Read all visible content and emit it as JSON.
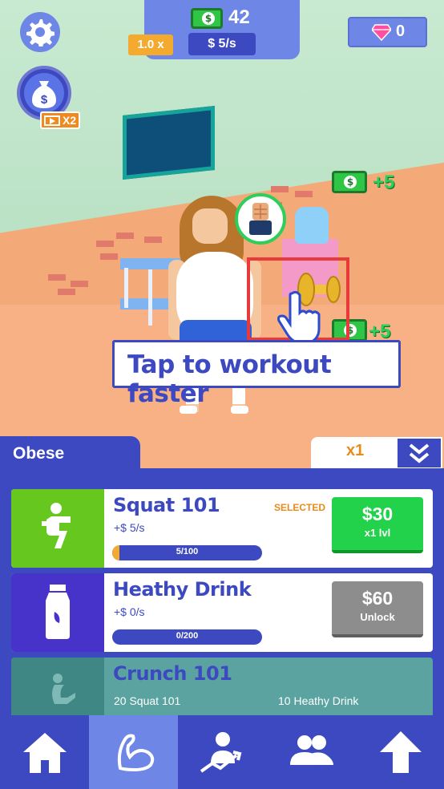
{
  "hud": {
    "coins": "42",
    "multiplier": "1.0 x",
    "rate": "$ 5/s",
    "gems": "0",
    "ad_badge": "X2"
  },
  "scene": {
    "floating_rewards": [
      "+5",
      "+5"
    ],
    "tap_hint": "Tap to workout faster"
  },
  "status": {
    "body_state": "Obese",
    "buy_multiplier": "x1"
  },
  "workouts": [
    {
      "name": "Squat 101",
      "income": "+$ 5/s",
      "progress_text": "5/100",
      "progress": 0.05,
      "selected_label": "SELECTED",
      "price": "$30",
      "button_sub": "x1 lvl",
      "icon": "squat-figure-icon",
      "color": "#66c71f"
    },
    {
      "name": "Heathy Drink",
      "income": "+$ 0/s",
      "progress_text": "0/200",
      "progress": 0,
      "price": "$60",
      "button_sub": "Unlock",
      "icon": "milk-bottle-icon",
      "color": "#4733c9"
    },
    {
      "name": "Crunch 101",
      "requirement_1": "20 Squat 101",
      "requirement_2": "10 Heathy Drink",
      "icon": "crunch-figure-icon"
    }
  ],
  "nav": [
    "home-icon",
    "muscle-icon",
    "progress-icon",
    "team-icon",
    "upgrade-arrow-icon"
  ],
  "colors": {
    "primary": "#3c49c0",
    "secondary": "#6e86e6",
    "accent_orange": "#f4a92f",
    "cash_green": "#2fc646",
    "buy_green": "#21d24a",
    "locked_grey": "#8d8d8d"
  }
}
